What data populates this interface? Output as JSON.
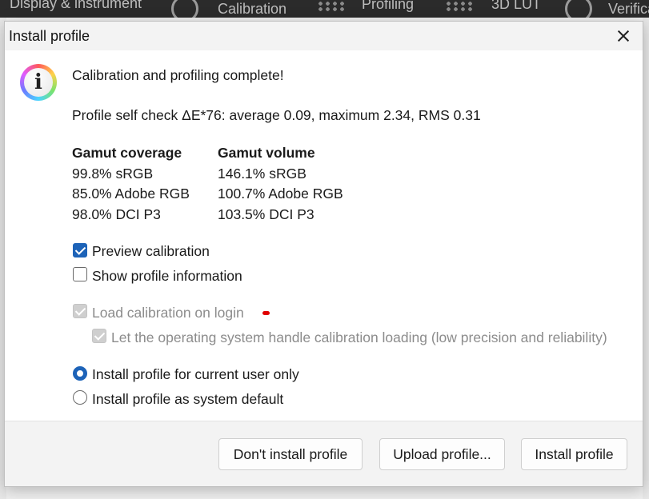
{
  "background_app": {
    "tabs": [
      "Display & instrument",
      "Calibration",
      "Profiling",
      "3D LUT",
      "Verification"
    ]
  },
  "dialog": {
    "title": "Install profile",
    "heading": "Calibration and profiling complete!",
    "self_check": "Profile self check ΔE*76: average 0.09, maximum 2.34, RMS 0.31",
    "gamut_coverage": {
      "header": "Gamut coverage",
      "rows": [
        "99.8% sRGB",
        "85.0% Adobe RGB",
        "98.0% DCI P3"
      ]
    },
    "gamut_volume": {
      "header": "Gamut volume",
      "rows": [
        "146.1% sRGB",
        "100.7% Adobe RGB",
        "103.5% DCI P3"
      ]
    },
    "options": {
      "preview_calibration": {
        "label": "Preview calibration",
        "checked": true
      },
      "show_profile_information": {
        "label": "Show profile information",
        "checked": false
      },
      "load_calibration_on_login": {
        "label": "Load calibration on login",
        "checked": true,
        "enabled": false
      },
      "os_handle_calibration": {
        "label": "Let the operating system handle calibration loading (low precision and reliability)",
        "checked": true,
        "enabled": false
      }
    },
    "install_scope": {
      "selected": "current_user",
      "current_user": "Install profile for current user only",
      "system_default": "Install profile as system default"
    },
    "buttons": {
      "dont_install": "Don't install profile",
      "upload": "Upload profile...",
      "install": "Install profile"
    }
  },
  "colors": {
    "accent": "#1d63b8",
    "dialog_background": "#ffffff",
    "footer_background": "#f3f3f3",
    "disabled_text": "#8c8c8c"
  },
  "icons": {
    "dialog": "info-icon",
    "close": "close-icon"
  }
}
